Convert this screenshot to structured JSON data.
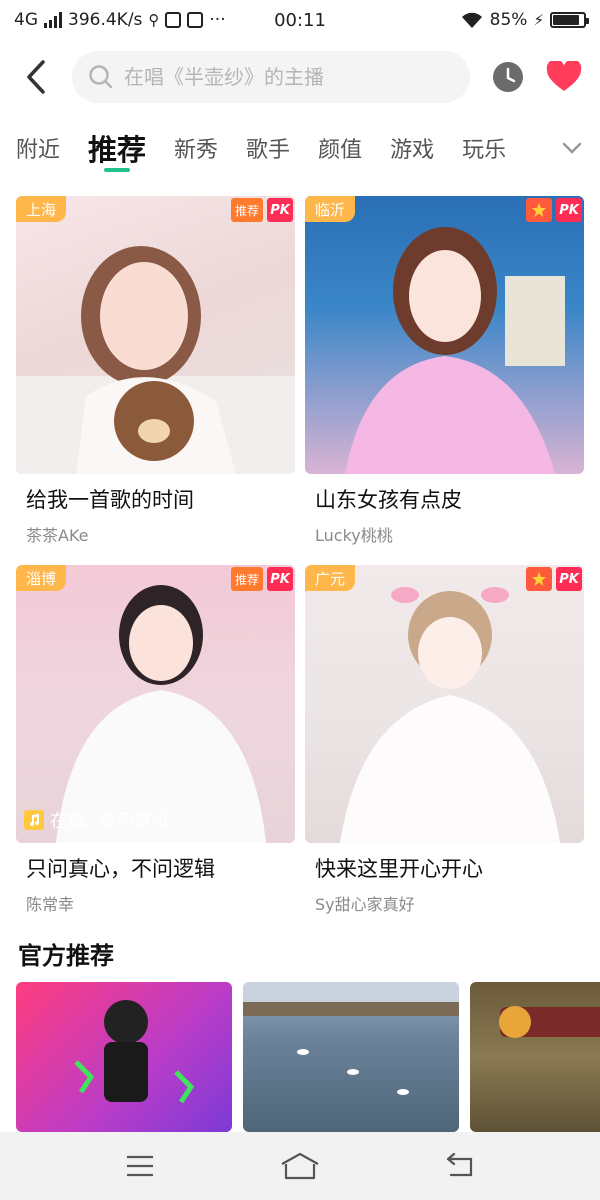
{
  "status_bar": {
    "network": "4G",
    "speed": "396.4K/s",
    "time": "00:11",
    "battery_percent": "85%",
    "battery_level": 0.85
  },
  "search": {
    "placeholder": "在唱《半壶纱》的主播"
  },
  "tabs": [
    {
      "label": "附近",
      "active": false
    },
    {
      "label": "推荐",
      "active": true
    },
    {
      "label": "新秀",
      "active": false
    },
    {
      "label": "歌手",
      "active": false
    },
    {
      "label": "颜值",
      "active": false
    },
    {
      "label": "游戏",
      "active": false
    },
    {
      "label": "玩乐",
      "active": false
    }
  ],
  "cards": [
    {
      "location": "上海",
      "tag": "推荐",
      "pk": "PK",
      "title": "给我一首歌的时间",
      "streamer": "茶茶AKe"
    },
    {
      "location": "临沂",
      "pk": "PK",
      "title": "山东女孩有点皮",
      "streamer": "Lucky桃桃"
    },
    {
      "location": "淄博",
      "tag": "推荐",
      "pk": "PK",
      "title": "只问真心，不问逻辑",
      "streamer": "陈常幸",
      "playing": "在播: 显而易见"
    },
    {
      "location": "广元",
      "pk": "PK",
      "title": "快来这里开心开心",
      "streamer": "Sy甜心家真好"
    }
  ],
  "official": {
    "title": "官方推荐"
  },
  "colors": {
    "accent": "#22c28a",
    "location_badge": "#ffb64a",
    "pk_badge": "#ff2c55",
    "heart": "#ff3d5a"
  }
}
